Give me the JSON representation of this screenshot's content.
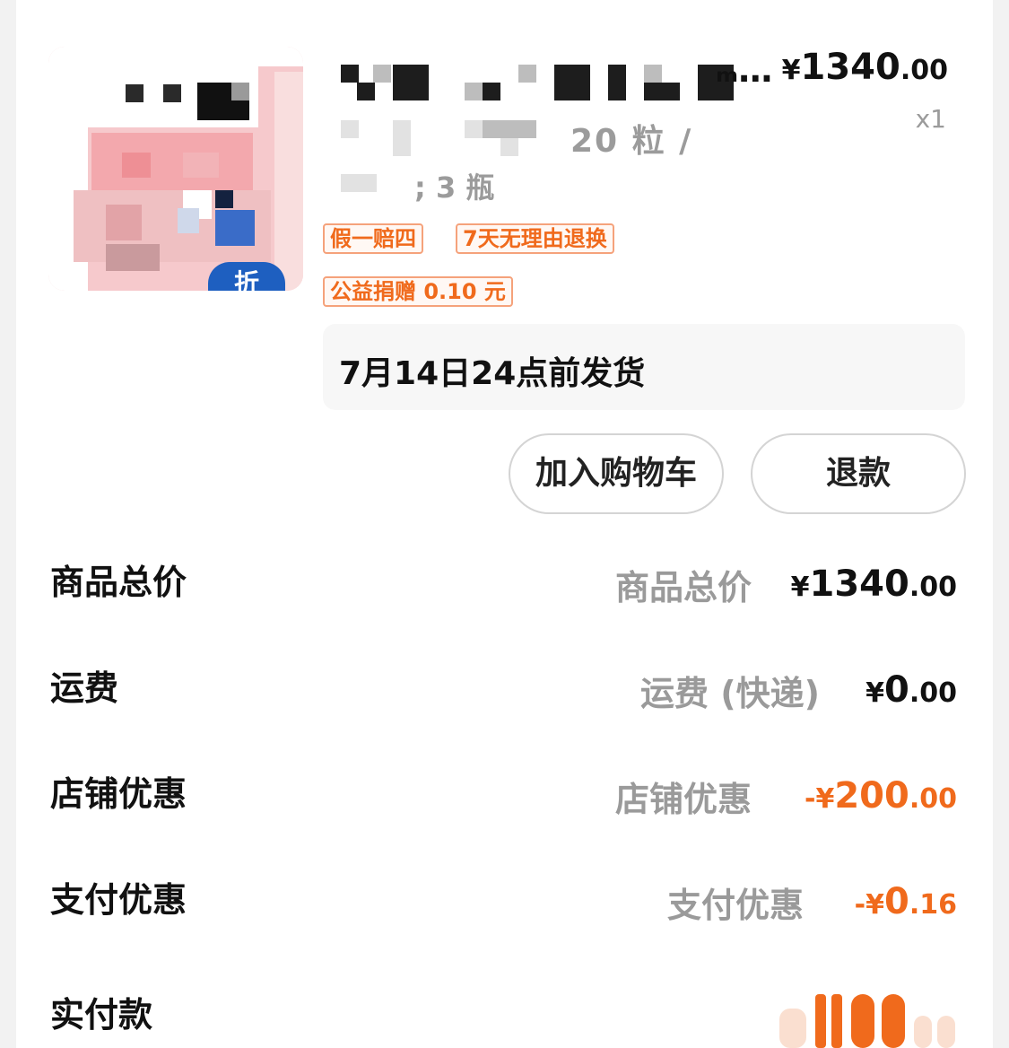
{
  "product": {
    "title_tail": "ₘ…",
    "spec_line1": "20 粒 /",
    "spec_line2": "; 3 瓶",
    "price": {
      "symbol": "¥",
      "integer": "1340",
      "decimal": ".00"
    },
    "quantity": "x1",
    "tags": [
      "假一赔四",
      "7天无理由退换",
      "公益捐赠 0.10 元"
    ],
    "thumbnail_badge": "折",
    "shipping_note": "7月14日24点前发货"
  },
  "actions": {
    "add_to_cart": "加入购物车",
    "refund": "退款"
  },
  "summary": {
    "goods_total": {
      "label": "商品总价",
      "sub": "商品总价",
      "symbol": "¥",
      "integer": "1340",
      "decimal": ".00"
    },
    "shipping": {
      "label": "运费",
      "sub": "运费 (快递)",
      "symbol": "¥",
      "integer": "0",
      "decimal": ".00"
    },
    "shop_discount": {
      "label": "店铺优惠",
      "sub": "店铺优惠",
      "sign": "-",
      "symbol": "¥",
      "integer": "200",
      "decimal": ".00"
    },
    "pay_discount": {
      "label": "支付优惠",
      "sub": "支付优惠",
      "sign": "-",
      "symbol": "¥",
      "integer": "0",
      "decimal": ".16"
    },
    "paid": {
      "label": "实付款"
    }
  },
  "colors": {
    "accent_orange": "#f06a1c",
    "tag_border": "#f5a27b",
    "thumbnail_pink": "#f6c9cc",
    "badge_blue": "#1e5fc0"
  }
}
